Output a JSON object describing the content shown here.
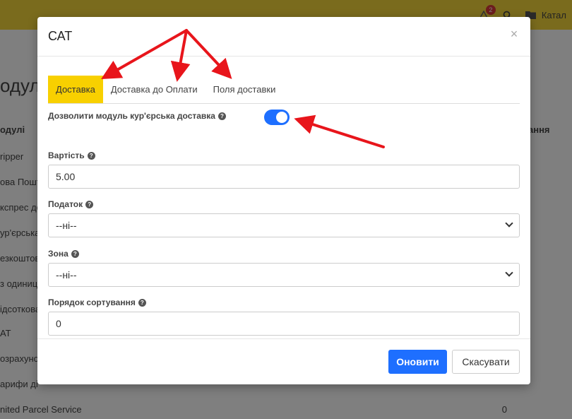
{
  "app": {
    "notification_count": "2",
    "catalog_label": "Катал",
    "page_heading": "одулі",
    "column_modules": "одулі",
    "column_right": "ання",
    "rows": [
      {
        "name": "ripper",
        "value": ""
      },
      {
        "name": "ова Пошт",
        "value": ""
      },
      {
        "name": "кспрес до",
        "value": ""
      },
      {
        "name": "ур'єрська",
        "value": ""
      },
      {
        "name": "езкоштов",
        "value": ""
      },
      {
        "name": "з одиниц",
        "value": ""
      },
      {
        "name": "ідсоткова",
        "value": ""
      },
      {
        "name": "АТ",
        "value": ""
      },
      {
        "name": "озрахуно",
        "value": ""
      },
      {
        "name": "арифи ді",
        "value": ""
      },
      {
        "name": "nited Parcel Service",
        "value": "0"
      }
    ]
  },
  "modal": {
    "title": "САТ",
    "close_symbol": "×",
    "tabs": [
      {
        "label": "Доставка",
        "active": true
      },
      {
        "label": "Доставка до Оплати",
        "active": false
      },
      {
        "label": "Поля доставки",
        "active": false
      }
    ],
    "fields": {
      "enable_label": "Дозволити модуль кур'єрська доставка",
      "enable_value": true,
      "cost_label": "Вартість",
      "cost_value": "5.00",
      "tax_label": "Податок",
      "tax_value": "--ні--",
      "zone_label": "Зона",
      "zone_value": "--ні--",
      "sort_label": "Порядок сортування",
      "sort_value": "0"
    },
    "buttons": {
      "update": "Оновити",
      "cancel": "Скасувати"
    }
  },
  "colors": {
    "accent_yellow": "#f8d000",
    "primary_blue": "#1e6fff",
    "annotation_red": "#e8151b"
  }
}
